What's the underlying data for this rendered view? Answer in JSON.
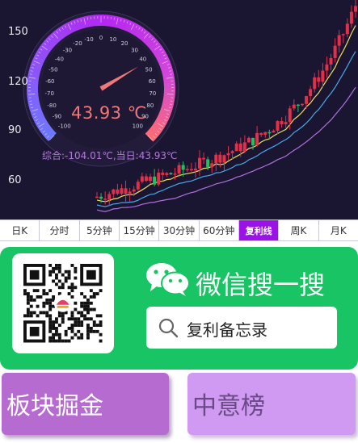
{
  "chart": {
    "y_axis_labels": [
      "150",
      "120",
      "90",
      "60"
    ],
    "gauge": {
      "value_text": "43.93 ℃",
      "value": 43.93,
      "scale_labels": [
        "-100",
        "-90",
        "-80",
        "-70",
        "-60",
        "-50",
        "-40",
        "-30",
        "-20",
        "-10",
        "0",
        "10",
        "20",
        "30",
        "40",
        "50",
        "60",
        "70",
        "80",
        "90",
        "100"
      ],
      "summary": "综合:-104.01℃,当日:43.93℃"
    },
    "colors": {
      "up": "#e0304a",
      "down": "#20c060",
      "ma_yellow": "#f0e060",
      "ma_blue": "#4aa8e8",
      "ma_purple": "#b070e0"
    }
  },
  "tabs": [
    {
      "label": "日K",
      "active": false
    },
    {
      "label": "分时",
      "active": false
    },
    {
      "label": "5分钟",
      "active": false
    },
    {
      "label": "15分钟",
      "active": false
    },
    {
      "label": "30分钟",
      "active": false
    },
    {
      "label": "60分钟",
      "active": false
    },
    {
      "label": "复利线",
      "active": true
    },
    {
      "label": "周K",
      "active": false
    },
    {
      "label": "月K",
      "active": false
    }
  ],
  "wechat": {
    "title": "微信搜一搜",
    "search_text": "复利备忘录",
    "icon": "wechat-icon"
  },
  "buttons": {
    "sector": "板块掘金",
    "rank": "中意榜"
  }
}
